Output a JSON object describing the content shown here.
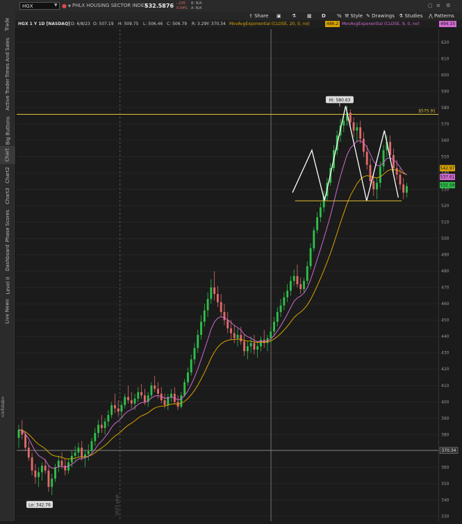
{
  "sidebar": {
    "tabs": [
      "Trade",
      "Times And Sales",
      "Active Trader",
      "Big Buttons",
      "Chart",
      "Chart2",
      "Chart3",
      "Phase Scores",
      "Dashboard",
      "Level II",
      "Live News"
    ],
    "active_tab": "Chart",
    "collapse_label": "<infotab>"
  },
  "header": {
    "symbol": "HGX",
    "description": "PHLX HOUSING SECTOR INDEX",
    "last_price": "532.5876",
    "change": "-.235",
    "change_pct": "0.04%",
    "bid": "B: N/A",
    "ask": "A: N/A"
  },
  "toolbar": {
    "share": "Share",
    "period": "D",
    "style": "Style",
    "drawings": "Drawings",
    "studies": "Studies",
    "patterns": "Patterns"
  },
  "info": {
    "title": "HGX 1 Y 1D [NASDAQ]",
    "date": "D: 6/8/23",
    "open": "O: 507.19",
    "high": "H: 509.75",
    "low": "L: 506.46",
    "close": "C: 506.79",
    "range": "R: 3.29",
    "y": "Y: 370.34",
    "ma20_label": "MovAvgExponential (CLOSE, 20, 0, no)",
    "ma20_value": "486.2",
    "ma9_label": "MovAvgExponential (CLOSE, 9, 0, no)",
    "ma9_value": "494.15"
  },
  "colors": {
    "background": "#1b1b1b",
    "up_candle": "#2fbf4a",
    "down_candle": "#e26a6a",
    "ma20": "#d9a400",
    "ma9": "#d06bd0",
    "resistance": "#e2c23a",
    "support": "#e2c23a",
    "pattern": "#ffffff",
    "cursor": "#8a8a8a"
  },
  "chart_data": {
    "type": "candlestick",
    "y_ticks": [
      330,
      340,
      350,
      360,
      370,
      380,
      390,
      400,
      410,
      420,
      430,
      440,
      450,
      460,
      470,
      480,
      490,
      500,
      510,
      520,
      530,
      540,
      550,
      560,
      570,
      580,
      590,
      600,
      610,
      620
    ],
    "ylim": [
      327,
      628
    ],
    "resistance_level": 575.91,
    "resistance_label": "$575.91",
    "support_level": 523,
    "high_label": "Hi: 580.63",
    "high_value": 580.63,
    "low_label": "Lo: 342.76",
    "low_value": 342.76,
    "cursor_price": 370.34,
    "cursor_label": "370.34",
    "year_label": "2023 year",
    "price_badges": [
      {
        "label": "542.97",
        "value": 542.97,
        "color": "#d9a400"
      },
      {
        "label": "537.61",
        "value": 537.61,
        "color": "#d06bd0"
      },
      {
        "label": "532.59",
        "value": 532.59,
        "color": "#2fbf4a"
      }
    ],
    "candles": [
      [
        378,
        386,
        372,
        383
      ],
      [
        383,
        389,
        377,
        380
      ],
      [
        380,
        382,
        370,
        372
      ],
      [
        372,
        376,
        364,
        366
      ],
      [
        366,
        369,
        355,
        358
      ],
      [
        358,
        362,
        350,
        354
      ],
      [
        354,
        360,
        348,
        357
      ],
      [
        357,
        363,
        352,
        361
      ],
      [
        361,
        365,
        356,
        358
      ],
      [
        358,
        361,
        345,
        348
      ],
      [
        348,
        356,
        343,
        353
      ],
      [
        353,
        362,
        351,
        360
      ],
      [
        360,
        367,
        357,
        364
      ],
      [
        364,
        369,
        359,
        361
      ],
      [
        361,
        365,
        355,
        358
      ],
      [
        358,
        365,
        356,
        363
      ],
      [
        363,
        370,
        360,
        367
      ],
      [
        367,
        373,
        364,
        369
      ],
      [
        369,
        375,
        366,
        372
      ],
      [
        372,
        376,
        364,
        366
      ],
      [
        366,
        371,
        360,
        368
      ],
      [
        368,
        374,
        364,
        370
      ],
      [
        370,
        378,
        368,
        376
      ],
      [
        376,
        384,
        373,
        381
      ],
      [
        381,
        389,
        378,
        386
      ],
      [
        386,
        392,
        381,
        384
      ],
      [
        384,
        390,
        380,
        388
      ],
      [
        388,
        395,
        385,
        392
      ],
      [
        392,
        400,
        390,
        398
      ],
      [
        398,
        405,
        393,
        396
      ],
      [
        396,
        401,
        391,
        394
      ],
      [
        394,
        400,
        390,
        398
      ],
      [
        398,
        405,
        396,
        403
      ],
      [
        403,
        410,
        399,
        401
      ],
      [
        401,
        406,
        396,
        399
      ],
      [
        399,
        405,
        395,
        402
      ],
      [
        402,
        409,
        400,
        406
      ],
      [
        406,
        411,
        402,
        404
      ],
      [
        404,
        408,
        398,
        400
      ],
      [
        400,
        406,
        397,
        404
      ],
      [
        404,
        412,
        402,
        410
      ],
      [
        410,
        416,
        406,
        408
      ],
      [
        408,
        412,
        402,
        405
      ],
      [
        405,
        409,
        399,
        401
      ],
      [
        401,
        405,
        396,
        398
      ],
      [
        398,
        405,
        395,
        403
      ],
      [
        403,
        408,
        400,
        405
      ],
      [
        405,
        409,
        399,
        400
      ],
      [
        400,
        404,
        395,
        397
      ],
      [
        397,
        406,
        396,
        404
      ],
      [
        404,
        414,
        403,
        412
      ],
      [
        412,
        421,
        410,
        418
      ],
      [
        418,
        429,
        416,
        426
      ],
      [
        426,
        436,
        423,
        433
      ],
      [
        433,
        444,
        430,
        441
      ],
      [
        441,
        453,
        438,
        449
      ],
      [
        449,
        460,
        446,
        456
      ],
      [
        456,
        467,
        452,
        463
      ],
      [
        463,
        475,
        460,
        470
      ],
      [
        470,
        480,
        462,
        466
      ],
      [
        466,
        471,
        458,
        461
      ],
      [
        461,
        466,
        452,
        455
      ],
      [
        455,
        460,
        447,
        450
      ],
      [
        450,
        455,
        442,
        445
      ],
      [
        445,
        450,
        438,
        442
      ],
      [
        442,
        447,
        436,
        439
      ],
      [
        439,
        445,
        434,
        441
      ],
      [
        441,
        446,
        435,
        437
      ],
      [
        437,
        441,
        428,
        431
      ],
      [
        431,
        437,
        426,
        434
      ],
      [
        434,
        440,
        430,
        436
      ],
      [
        436,
        441,
        429,
        432
      ],
      [
        432,
        437,
        427,
        434
      ],
      [
        434,
        440,
        431,
        438
      ],
      [
        438,
        444,
        433,
        436
      ],
      [
        436,
        441,
        431,
        439
      ],
      [
        439,
        446,
        436,
        443
      ],
      [
        443,
        452,
        441,
        449
      ],
      [
        449,
        458,
        446,
        455
      ],
      [
        455,
        463,
        452,
        459
      ],
      [
        459,
        467,
        456,
        464
      ],
      [
        464,
        472,
        461,
        468
      ],
      [
        468,
        477,
        465,
        474
      ],
      [
        474,
        481,
        471,
        477
      ],
      [
        477,
        484,
        470,
        472
      ],
      [
        472,
        476,
        466,
        469
      ],
      [
        469,
        476,
        467,
        474
      ],
      [
        474,
        486,
        472,
        483
      ],
      [
        483,
        497,
        481,
        494
      ],
      [
        494,
        507,
        492,
        505
      ],
      [
        505,
        516,
        503,
        513
      ],
      [
        513,
        522,
        510,
        519
      ],
      [
        519,
        529,
        516,
        526
      ],
      [
        526,
        537,
        523,
        534
      ],
      [
        534,
        546,
        532,
        543
      ],
      [
        543,
        557,
        541,
        554
      ],
      [
        554,
        566,
        551,
        563
      ],
      [
        563,
        573,
        559,
        569
      ],
      [
        569,
        576,
        565,
        572
      ],
      [
        572,
        581,
        569,
        577
      ],
      [
        577,
        579,
        568,
        571
      ],
      [
        571,
        574,
        562,
        566
      ],
      [
        566,
        571,
        559,
        568
      ],
      [
        568,
        572,
        558,
        561
      ],
      [
        561,
        565,
        550,
        553
      ],
      [
        553,
        557,
        542,
        545
      ],
      [
        545,
        549,
        532,
        535
      ],
      [
        535,
        540,
        526,
        530
      ],
      [
        530,
        537,
        524,
        534
      ],
      [
        534,
        547,
        531,
        544
      ],
      [
        544,
        557,
        541,
        554
      ],
      [
        554,
        563,
        550,
        559
      ],
      [
        559,
        563,
        548,
        551
      ],
      [
        551,
        555,
        540,
        543
      ],
      [
        543,
        548,
        536,
        539
      ],
      [
        539,
        543,
        530,
        533
      ],
      [
        533,
        537,
        524,
        528
      ],
      [
        528,
        534,
        525,
        532
      ]
    ],
    "pattern_points": [
      [
        0.654,
        528
      ],
      [
        0.7,
        554
      ],
      [
        0.73,
        523
      ],
      [
        0.78,
        581
      ],
      [
        0.83,
        523
      ],
      [
        0.872,
        566
      ],
      [
        0.905,
        525
      ]
    ]
  }
}
